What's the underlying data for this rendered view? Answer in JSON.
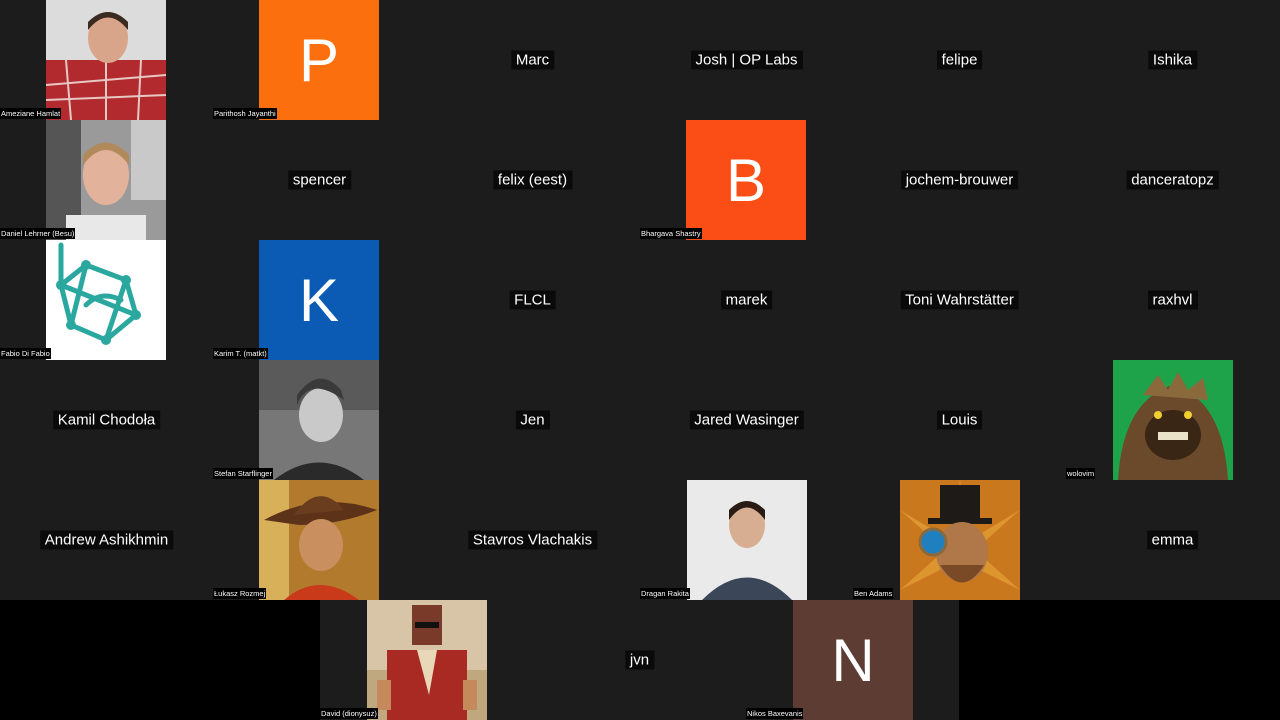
{
  "colors": {
    "background": "#1c1c1c",
    "avatar_p": "#fb6f0e",
    "avatar_b": "#fb4d16",
    "avatar_k": "#0b5bb5",
    "avatar_n": "#5d3d33"
  },
  "participants": {
    "r0c0": {
      "name": "Ameziane Hamlat",
      "icon": "person-photo"
    },
    "r0c1": {
      "name": "Parithosh Jayanthi",
      "letter": "P"
    },
    "r0c2": {
      "name": "Marc"
    },
    "r0c3": {
      "name": "Josh | OP Labs"
    },
    "r0c4": {
      "name": "felipe"
    },
    "r0c5": {
      "name": "Ishika"
    },
    "r1c0": {
      "name": "Daniel Lehrner (Besu)",
      "icon": "person-photo"
    },
    "r1c1": {
      "name": "spencer"
    },
    "r1c2": {
      "name": "felix (eest)"
    },
    "r1c3": {
      "name": "Bhargava Shastry",
      "letter": "B"
    },
    "r1c4": {
      "name": "jochem-brouwer"
    },
    "r1c5": {
      "name": "danceratopz"
    },
    "r2c0": {
      "name": "Fabio Di Fabio",
      "icon": "hyperledger-logo"
    },
    "r2c1": {
      "name": "Karim T. (matkt)",
      "letter": "K"
    },
    "r2c2": {
      "name": "FLCL"
    },
    "r2c3": {
      "name": "marek"
    },
    "r2c4": {
      "name": "Toni Wahrstätter"
    },
    "r2c5": {
      "name": "raxhvl"
    },
    "r3c0": {
      "name": "Kamil Chodoła"
    },
    "r3c1": {
      "name": "Stefan Starflinger",
      "icon": "person-photo"
    },
    "r3c2": {
      "name": "Jen"
    },
    "r3c3": {
      "name": "Jared Wasinger"
    },
    "r3c4": {
      "name": "Louis"
    },
    "r3c5": {
      "name": "wolovim",
      "icon": "monster-avatar"
    },
    "r4c0": {
      "name": "Andrew Ashikhmin"
    },
    "r4c1": {
      "name": "Łukasz Rozmej",
      "icon": "cowboy-photo"
    },
    "r4c2": {
      "name": "Stavros Vlachakis"
    },
    "r4c3": {
      "name": "Dragan Rakita",
      "icon": "person-photo"
    },
    "r4c4": {
      "name": "Ben Adams",
      "icon": "steampunk-avatar"
    },
    "r4c5": {
      "name": "emma"
    },
    "r5c0": {
      "name": "David (dionysuz)",
      "icon": "game-character-avatar"
    },
    "r5c1": {
      "name": "jvn"
    },
    "r5c2": {
      "name": "Nikos Baxevanis",
      "letter": "N"
    }
  }
}
